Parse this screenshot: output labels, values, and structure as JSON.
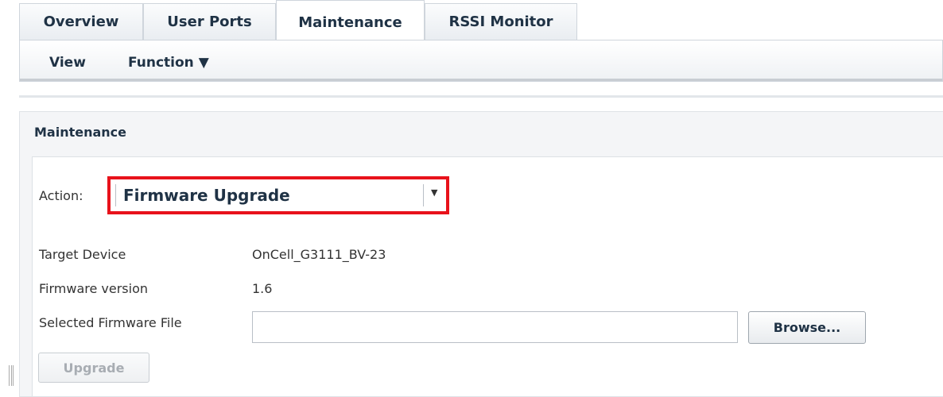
{
  "tabs": [
    {
      "label": "Overview"
    },
    {
      "label": "User Ports"
    },
    {
      "label": "Maintenance",
      "active": true
    },
    {
      "label": "RSSI Monitor"
    }
  ],
  "subnav": {
    "view_label": "View",
    "function_label": "Function ▼"
  },
  "panel": {
    "title": "Maintenance",
    "action_label": "Action:",
    "action_value": "Firmware Upgrade",
    "action_arrow": "▼",
    "target_device_label": "Target Device",
    "target_device_value": "OnCell_G3111_BV-23",
    "firmware_version_label": "Firmware version",
    "firmware_version_value": "1.6",
    "firmware_file_label": "Selected Firmware File",
    "firmware_file_value": "",
    "browse_label": "Browse...",
    "upgrade_label": "Upgrade"
  },
  "colors": {
    "highlight": "#e8121b",
    "text_dark": "#1f3245",
    "disabled_text": "#a8adb3"
  }
}
